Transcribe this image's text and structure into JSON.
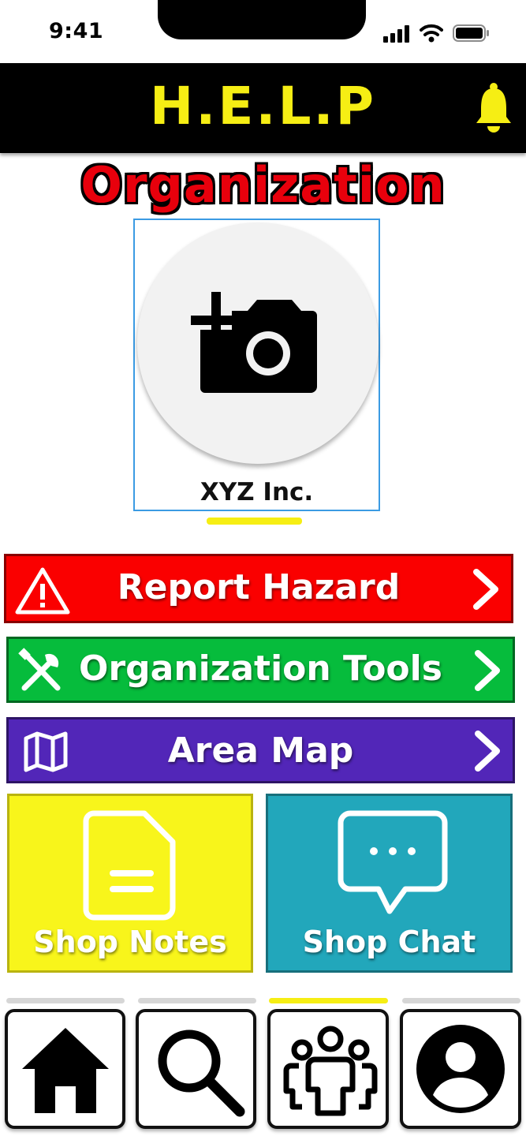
{
  "status_bar": {
    "time": "9:41"
  },
  "header": {
    "title": "H.E.L.P",
    "bell_icon": "bell-icon",
    "title_color": "#f6ee14"
  },
  "profile": {
    "heading": "Organization",
    "org_name": "XYZ Inc.",
    "photo_icon": "add-photo-camera-icon"
  },
  "menu": [
    {
      "label": "Report Hazard",
      "icon": "warning-triangle-icon",
      "color": "#fa0000"
    },
    {
      "label": "Organization Tools",
      "icon": "wrench-screwdriver-icon",
      "color": "#06bc3c"
    },
    {
      "label": "Area Map",
      "icon": "map-icon",
      "color": "#5226b8"
    }
  ],
  "tiles": [
    {
      "label": "Shop Notes",
      "icon": "note-document-icon",
      "color": "#f8f51b"
    },
    {
      "label": "Shop Chat",
      "icon": "chat-bubble-icon",
      "color": "#22a7bb"
    }
  ],
  "bottom_nav": {
    "items": [
      {
        "icon": "home-icon",
        "active": false
      },
      {
        "icon": "search-icon",
        "active": false
      },
      {
        "icon": "group-icon",
        "active": true
      },
      {
        "icon": "profile-icon",
        "active": false
      }
    ],
    "active_color": "#f6ee14"
  }
}
